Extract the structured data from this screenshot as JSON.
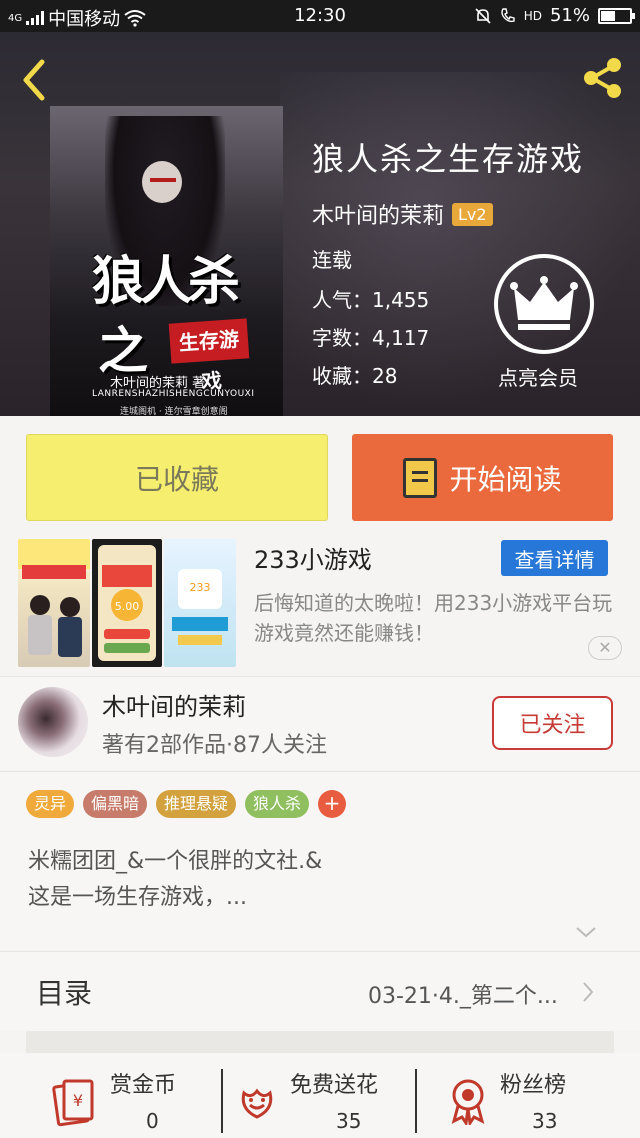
{
  "status_bar": {
    "network": "4G",
    "carrier": "中国移动",
    "time": "12:30",
    "hd": "HD",
    "battery": "51%",
    "battery_level": 0.51
  },
  "header": {
    "back_icon": "chevron-left-icon",
    "share_icon": "share-icon",
    "cover": {
      "title_line1": "狼人杀",
      "title_line2": "之",
      "stamp": "生存游戏",
      "author_text": "木叶间的茉莉 著",
      "pinyin": "LANRENSHAZHISHENGCUNYOUXI",
      "publisher": "连城阁机 · 连尔雪章创意阁"
    },
    "title": "狼人杀之生存游戏",
    "author": "木叶间的茉莉",
    "level": "Lv2",
    "status": "连载",
    "popularity": "人气：1,455",
    "word_count": "字数：4,117",
    "favorites": "收藏：28",
    "vip_label": "点亮会员",
    "vip_icon": "crown-icon"
  },
  "actions": {
    "favorite_label": "已收藏",
    "read_label": "开始阅读",
    "read_icon": "book-icon"
  },
  "ad": {
    "title": "233小游戏",
    "button": "查看详情",
    "description": "后悔知道的太晚啦！用233小游戏平台玩游戏竟然还能赚钱！",
    "close": "✕",
    "img_amount": "5.00",
    "img_badge": "233"
  },
  "author_row": {
    "name": "木叶间的茉莉",
    "stats": "著有2部作品·87人关注",
    "follow_label": "已关注"
  },
  "tags": [
    {
      "label": "灵异",
      "color": "#f0a93b"
    },
    {
      "label": "偏黑暗",
      "color": "#c77b6a"
    },
    {
      "label": "推理悬疑",
      "color": "#d3a23e"
    },
    {
      "label": "狼人杀",
      "color": "#8fbf5f"
    }
  ],
  "tag_add": "+",
  "intro": "米糯团团_&一个很胖的文社.&\n这是一场生存游戏，...",
  "toc": {
    "label": "目录",
    "latest": "03-21·4._第二个..."
  },
  "bottom": {
    "reward": {
      "label": "赏金币",
      "value": "0",
      "icon": "coin-envelope-icon"
    },
    "flowers": {
      "label": "免费送花",
      "value": "35",
      "icon": "flower-icon"
    },
    "fans": {
      "label": "粉丝榜",
      "value": "33",
      "icon": "medal-icon"
    }
  },
  "colors": {
    "accent_orange": "#ea6a3d",
    "favorite_yellow": "#f5ee6e",
    "ad_blue": "#2677d8",
    "follow_red": "#c83a35"
  }
}
